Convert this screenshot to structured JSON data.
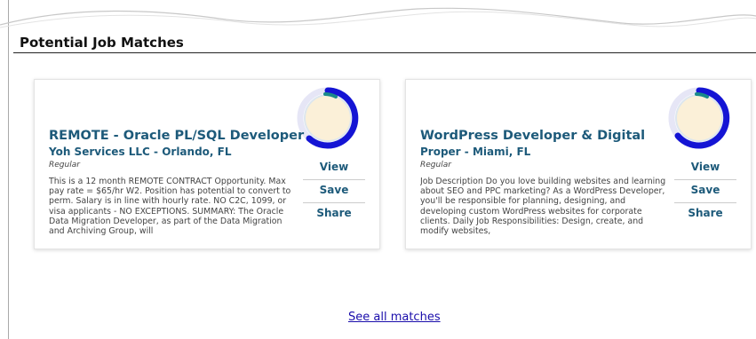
{
  "section": {
    "title": "Potential Job Matches"
  },
  "colors": {
    "link": "#1a0dab",
    "title": "#1d5a7a",
    "ring_fill": "#1414d4",
    "ring_accent": "#1a8a8a",
    "ring_track": "#e6e6f6",
    "ring_center": "#fbf0d8"
  },
  "jobs": [
    {
      "title": "REMOTE - Oracle PL/SQL Developer",
      "company_location": "Yoh Services LLC - Orlando, FL",
      "job_type": "Regular",
      "description": "This is a 12 month REMOTE CONTRACT Opportunity. Max pay rate = $65/hr W2. Position has potential to convert to perm. Salary is in line with hourly rate. NO C2C, 1099, or visa applicants - NO EXCEPTIONS. SUMMARY: The Oracle Data Migration Developer, as part of the Data Migration and Archiving Group, will",
      "match_icon": "match-score-ring",
      "actions": {
        "view": "View",
        "save": "Save",
        "share": "Share"
      }
    },
    {
      "title": "WordPress Developer & Digital",
      "company_location": "Proper - Miami, FL",
      "job_type": "Regular",
      "description": "Job Description Do you love building websites and learning about SEO and PPC marketing? As a WordPress Developer, you'll be responsible for planning, designing, and developing custom WordPress websites for corporate clients. Daily Job Responsibilities: Design, create, and modify websites,",
      "match_icon": "match-score-ring",
      "actions": {
        "view": "View",
        "save": "Save",
        "share": "Share"
      }
    }
  ],
  "footer": {
    "see_all": "See all matches"
  }
}
